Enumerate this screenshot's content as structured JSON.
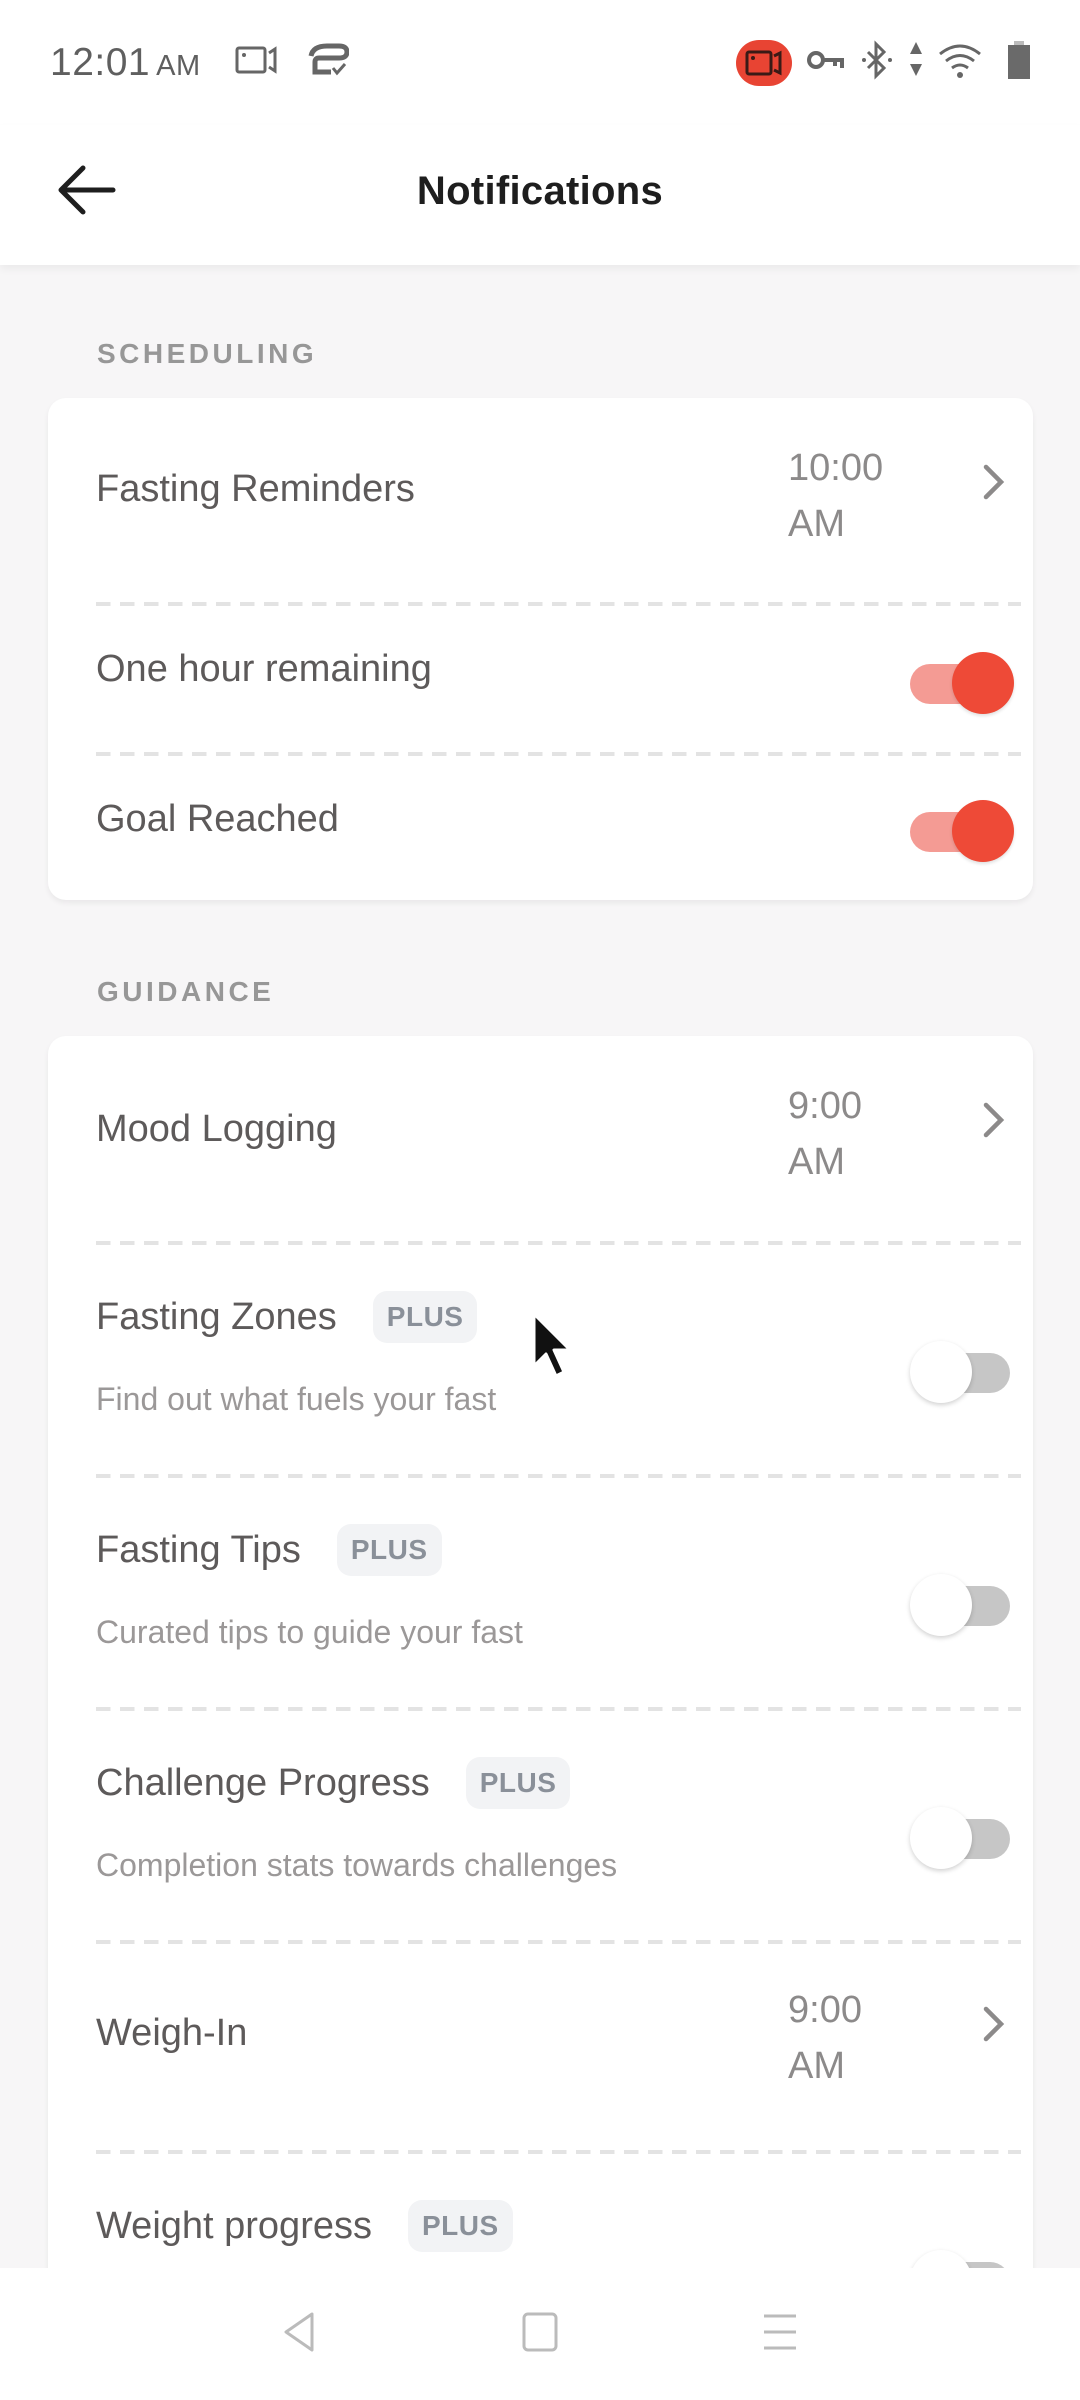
{
  "status_bar": {
    "time": "12:01",
    "ampm": "AM",
    "left_icons": [
      "screen-record-icon",
      "sync-check-icon"
    ],
    "right_icons": [
      "recording-active-icon",
      "vpn-key-icon",
      "bluetooth-icon",
      "data-arrows-icon",
      "wifi-icon",
      "battery-icon"
    ],
    "record_color": "#e84433"
  },
  "app_bar": {
    "title": "Notifications",
    "back_icon": "arrow-left-icon"
  },
  "sections": [
    {
      "label": "SCHEDULING",
      "rows": [
        {
          "title": "Fasting Reminders",
          "time_line1": "10:00",
          "time_line2": "AM",
          "control": "chevron"
        },
        {
          "title": "One hour remaining",
          "control": "toggle",
          "on": true
        },
        {
          "title": "Goal Reached",
          "control": "toggle",
          "on": true
        }
      ]
    },
    {
      "label": "GUIDANCE",
      "rows": [
        {
          "title": "Mood Logging",
          "time_line1": "9:00",
          "time_line2": "AM",
          "control": "chevron"
        },
        {
          "title": "Fasting Zones",
          "badge": "PLUS",
          "subtitle": "Find out what fuels your fast",
          "control": "toggle",
          "on": false
        },
        {
          "title": "Fasting Tips",
          "badge": "PLUS",
          "subtitle": "Curated tips to guide your fast",
          "control": "toggle",
          "on": false
        },
        {
          "title": "Challenge Progress",
          "badge": "PLUS",
          "subtitle": "Completion stats towards challenges",
          "control": "toggle",
          "on": false
        },
        {
          "title": "Weigh-In",
          "time_line1": "9:00",
          "time_line2": "AM",
          "control": "chevron"
        },
        {
          "title": "Weight progress",
          "badge": "PLUS",
          "control": "toggle",
          "on": false
        }
      ]
    }
  ],
  "colors": {
    "accent": "#ee4a37",
    "accent_track": "#f49b94",
    "off_track": "#c6c6c6",
    "background": "#f7f6f7"
  },
  "nav_bar": {
    "buttons": [
      "back-triangle-icon",
      "home-square-icon",
      "menu-lines-icon"
    ]
  }
}
